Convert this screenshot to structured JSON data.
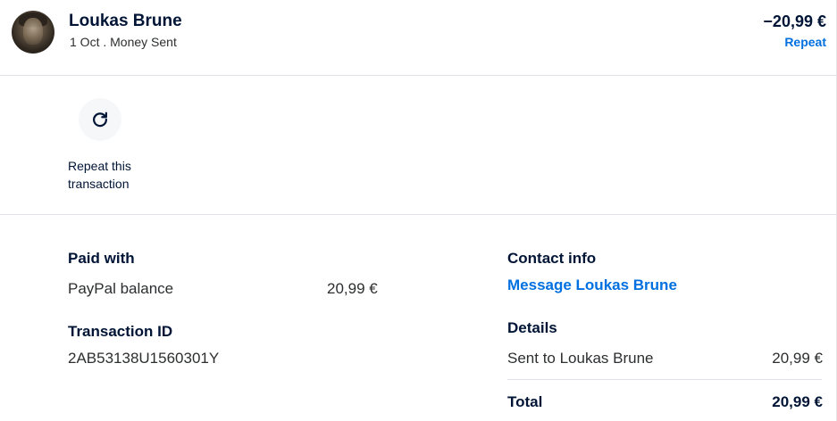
{
  "header": {
    "name": "Loukas Brune",
    "date": "1 Oct",
    "separator": ".",
    "type": "Money Sent",
    "amount": "−20,99 €",
    "repeat_label": "Repeat"
  },
  "actions": {
    "repeat_line1": "Repeat this",
    "repeat_line2": "transaction"
  },
  "paid_with": {
    "title": "Paid with",
    "method": "PayPal balance",
    "amount": "20,99 €"
  },
  "transaction": {
    "title": "Transaction ID",
    "id": "2AB53138U1560301Y"
  },
  "contact": {
    "title": "Contact info",
    "message_link": "Message Loukas Brune"
  },
  "details": {
    "title": "Details",
    "sent_label": "Sent to Loukas Brune",
    "sent_amount": "20,99 €",
    "total_label": "Total",
    "total_amount": "20,99 €"
  },
  "colors": {
    "link": "#0070e0",
    "text": "#001435",
    "divider": "#dfe3e8"
  }
}
